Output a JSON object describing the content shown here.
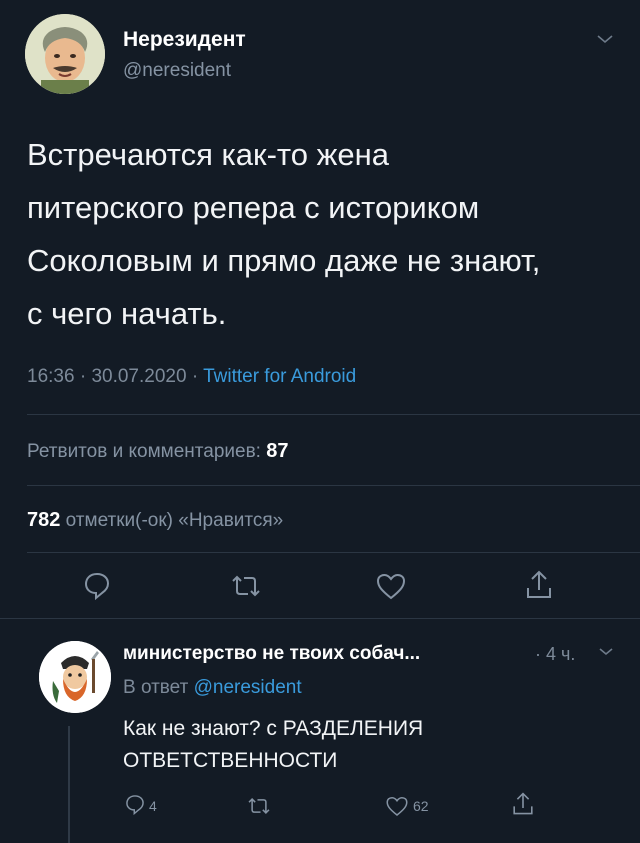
{
  "tweet": {
    "author_name": "Нерезидент",
    "author_handle": "@neresident",
    "text_lines": [
      "Встречаются как-то жена",
      "питерского репера с историком",
      "Соколовым и прямо даже не знают,",
      "с чего начать."
    ],
    "time": "16:36",
    "date": "30.07.2020",
    "separator": "·",
    "source": "Twitter for Android",
    "retweets_label": "Ретвитов и комментариев:",
    "retweets_count": "87",
    "likes_count": "782",
    "likes_label": "отметки(-ок) «Нравится»"
  },
  "actions": [
    "reply-icon",
    "retweet-icon",
    "like-icon",
    "share-icon"
  ],
  "reply": {
    "author_name": "министерство не твоих собач...",
    "time": "4 ч.",
    "replying_prefix": "В ответ",
    "replying_handle": "@neresident",
    "text_lines": [
      "Как не знают? с РАЗДЕЛЕНИЯ",
      "ОТВЕТСТВЕННОСТИ"
    ],
    "reply_count": "4",
    "like_count": "62"
  },
  "colors": {
    "background": "#131b25",
    "link": "#3a9bdc",
    "muted": "#8593a3"
  }
}
